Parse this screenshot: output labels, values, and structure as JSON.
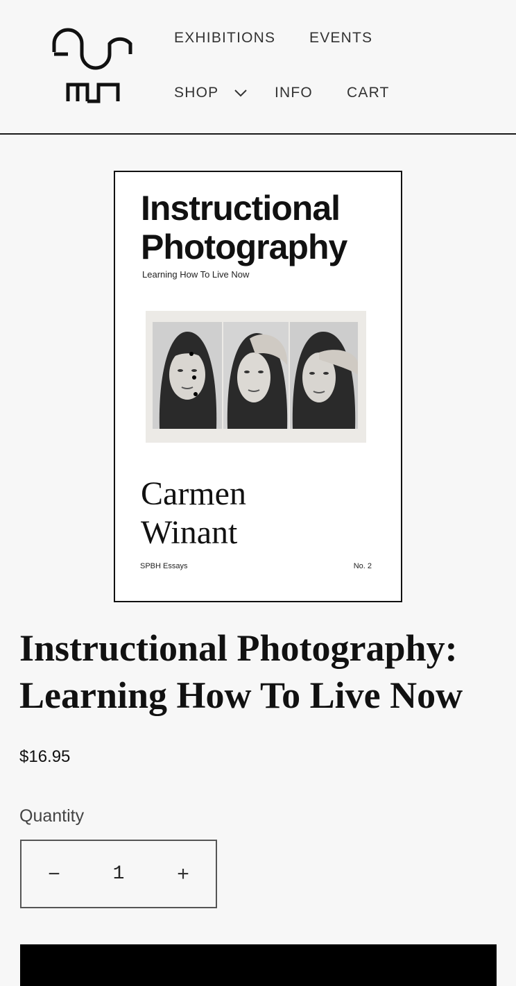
{
  "header": {
    "nav": {
      "exhibitions": "EXHIBITIONS",
      "events": "EVENTS",
      "shop": "SHOP",
      "info": "INFO",
      "cart": "CART"
    }
  },
  "cover": {
    "title_line1": "Instructional",
    "title_line2": "Photography",
    "subtitle": "Learning How To Live Now",
    "author_line1": "Carmen",
    "author_line2": "Winant",
    "series": "SPBH Essays",
    "number": "No. 2"
  },
  "product": {
    "title_line1": "Instructional Photography:",
    "title_line2": "Learning How To Live Now",
    "price": "$16.95",
    "quantity_label": "Quantity",
    "quantity_value": "1",
    "decrease_symbol": "−",
    "increase_symbol": "+"
  },
  "colors": {
    "background": "#f7f7f7",
    "text": "#1a1a1a",
    "button": "#000000"
  }
}
